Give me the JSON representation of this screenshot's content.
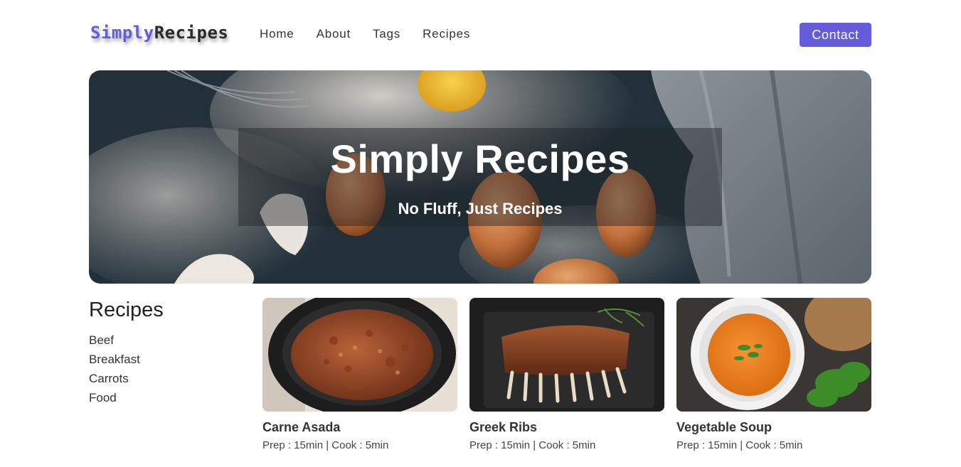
{
  "brand": {
    "first": "Simply",
    "second": "Recipes",
    "accent_color": "#645cdb"
  },
  "nav": {
    "links": [
      "Home",
      "About",
      "Tags",
      "Recipes"
    ],
    "contact_label": "Contact"
  },
  "hero": {
    "title": "Simply Recipes",
    "subtitle": "No Fluff, Just Recipes"
  },
  "tags": {
    "title": "Recipes",
    "items": [
      "Beef",
      "Breakfast",
      "Carrots",
      "Food"
    ]
  },
  "recipes": [
    {
      "name": "Carne Asada",
      "meta": "Prep : 15min | Cook : 5min",
      "image": "skillet-meat-image"
    },
    {
      "name": "Greek Ribs",
      "meta": "Prep : 15min | Cook : 5min",
      "image": "ribs-image"
    },
    {
      "name": "Vegetable Soup",
      "meta": "Prep : 15min | Cook : 5min",
      "image": "soup-image"
    }
  ]
}
